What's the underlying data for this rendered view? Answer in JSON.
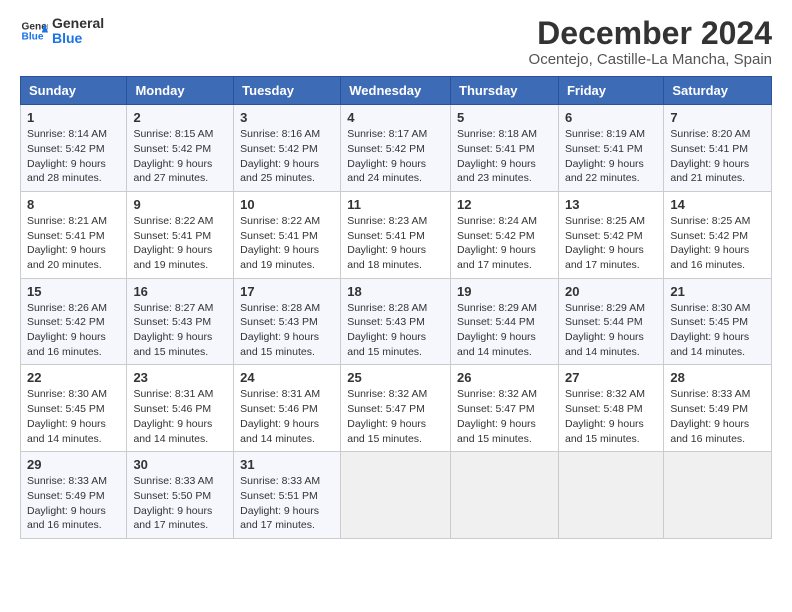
{
  "header": {
    "logo_general": "General",
    "logo_blue": "Blue",
    "title": "December 2024",
    "subtitle": "Ocentejo, Castille-La Mancha, Spain"
  },
  "calendar": {
    "days_of_week": [
      "Sunday",
      "Monday",
      "Tuesday",
      "Wednesday",
      "Thursday",
      "Friday",
      "Saturday"
    ],
    "weeks": [
      [
        null,
        {
          "day": "2",
          "sunrise": "Sunrise: 8:15 AM",
          "sunset": "Sunset: 5:42 PM",
          "daylight": "Daylight: 9 hours and 27 minutes."
        },
        {
          "day": "3",
          "sunrise": "Sunrise: 8:16 AM",
          "sunset": "Sunset: 5:42 PM",
          "daylight": "Daylight: 9 hours and 25 minutes."
        },
        {
          "day": "4",
          "sunrise": "Sunrise: 8:17 AM",
          "sunset": "Sunset: 5:42 PM",
          "daylight": "Daylight: 9 hours and 24 minutes."
        },
        {
          "day": "5",
          "sunrise": "Sunrise: 8:18 AM",
          "sunset": "Sunset: 5:41 PM",
          "daylight": "Daylight: 9 hours and 23 minutes."
        },
        {
          "day": "6",
          "sunrise": "Sunrise: 8:19 AM",
          "sunset": "Sunset: 5:41 PM",
          "daylight": "Daylight: 9 hours and 22 minutes."
        },
        {
          "day": "7",
          "sunrise": "Sunrise: 8:20 AM",
          "sunset": "Sunset: 5:41 PM",
          "daylight": "Daylight: 9 hours and 21 minutes."
        }
      ],
      [
        {
          "day": "1",
          "sunrise": "Sunrise: 8:14 AM",
          "sunset": "Sunset: 5:42 PM",
          "daylight": "Daylight: 9 hours and 28 minutes."
        },
        {
          "day": "9",
          "sunrise": "Sunrise: 8:22 AM",
          "sunset": "Sunset: 5:41 PM",
          "daylight": "Daylight: 9 hours and 19 minutes."
        },
        {
          "day": "10",
          "sunrise": "Sunrise: 8:22 AM",
          "sunset": "Sunset: 5:41 PM",
          "daylight": "Daylight: 9 hours and 19 minutes."
        },
        {
          "day": "11",
          "sunrise": "Sunrise: 8:23 AM",
          "sunset": "Sunset: 5:41 PM",
          "daylight": "Daylight: 9 hours and 18 minutes."
        },
        {
          "day": "12",
          "sunrise": "Sunrise: 8:24 AM",
          "sunset": "Sunset: 5:42 PM",
          "daylight": "Daylight: 9 hours and 17 minutes."
        },
        {
          "day": "13",
          "sunrise": "Sunrise: 8:25 AM",
          "sunset": "Sunset: 5:42 PM",
          "daylight": "Daylight: 9 hours and 17 minutes."
        },
        {
          "day": "14",
          "sunrise": "Sunrise: 8:25 AM",
          "sunset": "Sunset: 5:42 PM",
          "daylight": "Daylight: 9 hours and 16 minutes."
        }
      ],
      [
        {
          "day": "8",
          "sunrise": "Sunrise: 8:21 AM",
          "sunset": "Sunset: 5:41 PM",
          "daylight": "Daylight: 9 hours and 20 minutes."
        },
        {
          "day": "16",
          "sunrise": "Sunrise: 8:27 AM",
          "sunset": "Sunset: 5:43 PM",
          "daylight": "Daylight: 9 hours and 15 minutes."
        },
        {
          "day": "17",
          "sunrise": "Sunrise: 8:28 AM",
          "sunset": "Sunset: 5:43 PM",
          "daylight": "Daylight: 9 hours and 15 minutes."
        },
        {
          "day": "18",
          "sunrise": "Sunrise: 8:28 AM",
          "sunset": "Sunset: 5:43 PM",
          "daylight": "Daylight: 9 hours and 15 minutes."
        },
        {
          "day": "19",
          "sunrise": "Sunrise: 8:29 AM",
          "sunset": "Sunset: 5:44 PM",
          "daylight": "Daylight: 9 hours and 14 minutes."
        },
        {
          "day": "20",
          "sunrise": "Sunrise: 8:29 AM",
          "sunset": "Sunset: 5:44 PM",
          "daylight": "Daylight: 9 hours and 14 minutes."
        },
        {
          "day": "21",
          "sunrise": "Sunrise: 8:30 AM",
          "sunset": "Sunset: 5:45 PM",
          "daylight": "Daylight: 9 hours and 14 minutes."
        }
      ],
      [
        {
          "day": "15",
          "sunrise": "Sunrise: 8:26 AM",
          "sunset": "Sunset: 5:42 PM",
          "daylight": "Daylight: 9 hours and 16 minutes."
        },
        {
          "day": "23",
          "sunrise": "Sunrise: 8:31 AM",
          "sunset": "Sunset: 5:46 PM",
          "daylight": "Daylight: 9 hours and 14 minutes."
        },
        {
          "day": "24",
          "sunrise": "Sunrise: 8:31 AM",
          "sunset": "Sunset: 5:46 PM",
          "daylight": "Daylight: 9 hours and 14 minutes."
        },
        {
          "day": "25",
          "sunrise": "Sunrise: 8:32 AM",
          "sunset": "Sunset: 5:47 PM",
          "daylight": "Daylight: 9 hours and 15 minutes."
        },
        {
          "day": "26",
          "sunrise": "Sunrise: 8:32 AM",
          "sunset": "Sunset: 5:47 PM",
          "daylight": "Daylight: 9 hours and 15 minutes."
        },
        {
          "day": "27",
          "sunrise": "Sunrise: 8:32 AM",
          "sunset": "Sunset: 5:48 PM",
          "daylight": "Daylight: 9 hours and 15 minutes."
        },
        {
          "day": "28",
          "sunrise": "Sunrise: 8:33 AM",
          "sunset": "Sunset: 5:49 PM",
          "daylight": "Daylight: 9 hours and 16 minutes."
        }
      ],
      [
        {
          "day": "22",
          "sunrise": "Sunrise: 8:30 AM",
          "sunset": "Sunset: 5:45 PM",
          "daylight": "Daylight: 9 hours and 14 minutes."
        },
        {
          "day": "30",
          "sunrise": "Sunrise: 8:33 AM",
          "sunset": "Sunset: 5:50 PM",
          "daylight": "Daylight: 9 hours and 17 minutes."
        },
        {
          "day": "31",
          "sunrise": "Sunrise: 8:33 AM",
          "sunset": "Sunset: 5:51 PM",
          "daylight": "Daylight: 9 hours and 17 minutes."
        },
        null,
        null,
        null,
        null
      ],
      [
        {
          "day": "29",
          "sunrise": "Sunrise: 8:33 AM",
          "sunset": "Sunset: 5:49 PM",
          "daylight": "Daylight: 9 hours and 16 minutes."
        },
        null,
        null,
        null,
        null,
        null,
        null
      ]
    ]
  }
}
